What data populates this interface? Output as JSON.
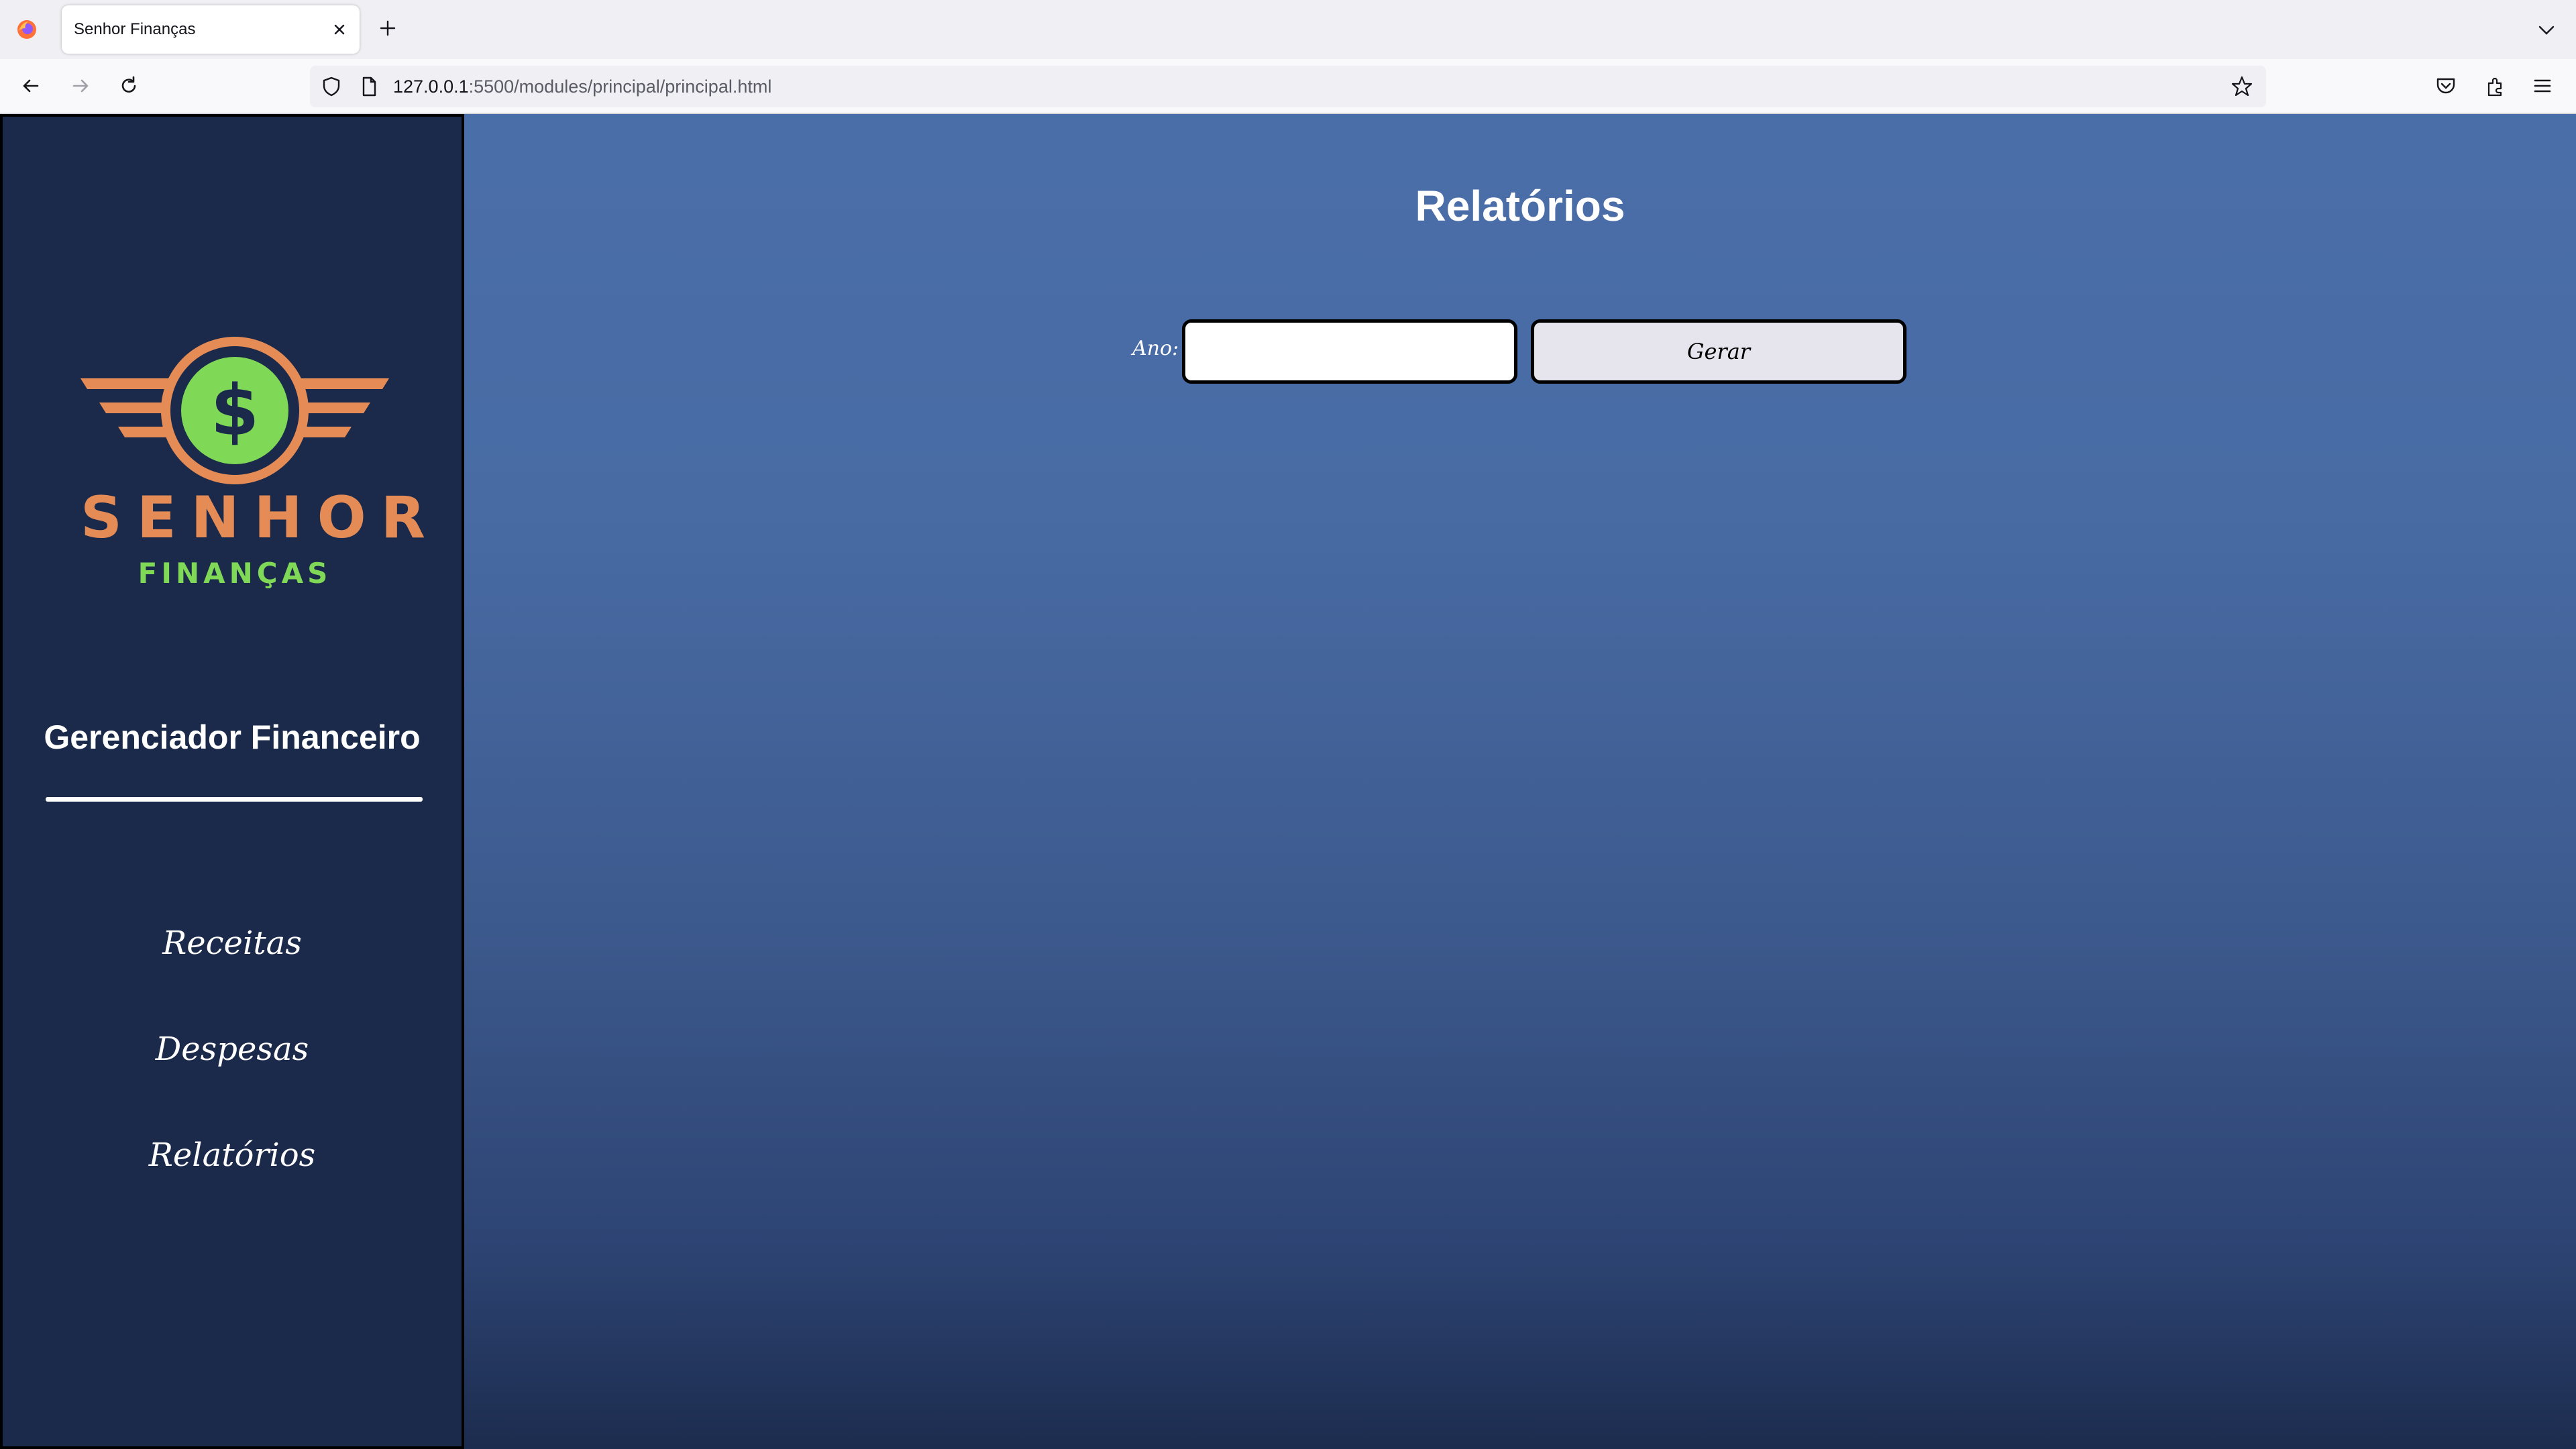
{
  "browser": {
    "tab_title": "Senhor Finanças",
    "url_host": "127.0.0.1",
    "url_rest": ":5500/modules/principal/principal.html",
    "icons": {
      "app": "firefox-icon",
      "close_tab": "close-icon",
      "new_tab": "plus-icon",
      "tab_list": "chevron-down-icon",
      "back": "back-arrow-icon",
      "forward": "forward-arrow-icon",
      "reload": "reload-icon",
      "shield": "shield-icon",
      "page": "page-icon",
      "bookmark": "star-icon",
      "pocket": "pocket-icon",
      "extensions": "extensions-icon",
      "menu": "hamburger-menu-icon"
    }
  },
  "sidebar": {
    "logo": {
      "title": "SENHOR",
      "subtitle": "FINANÇAS",
      "symbol": "$"
    },
    "heading": "Gerenciador Financeiro",
    "items": [
      {
        "label": "Receitas"
      },
      {
        "label": "Despesas"
      },
      {
        "label": "Relatórios"
      }
    ]
  },
  "main": {
    "title": "Relatórios",
    "year_label": "Ano:",
    "year_value": "",
    "generate_label": "Gerar"
  },
  "colors": {
    "sidebar_bg": "#1b2a4a",
    "main_gradient_top": "#4a6ea8",
    "main_gradient_bottom": "#1c2c4e",
    "logo_orange": "#e58b55",
    "logo_green": "#7fd957"
  }
}
